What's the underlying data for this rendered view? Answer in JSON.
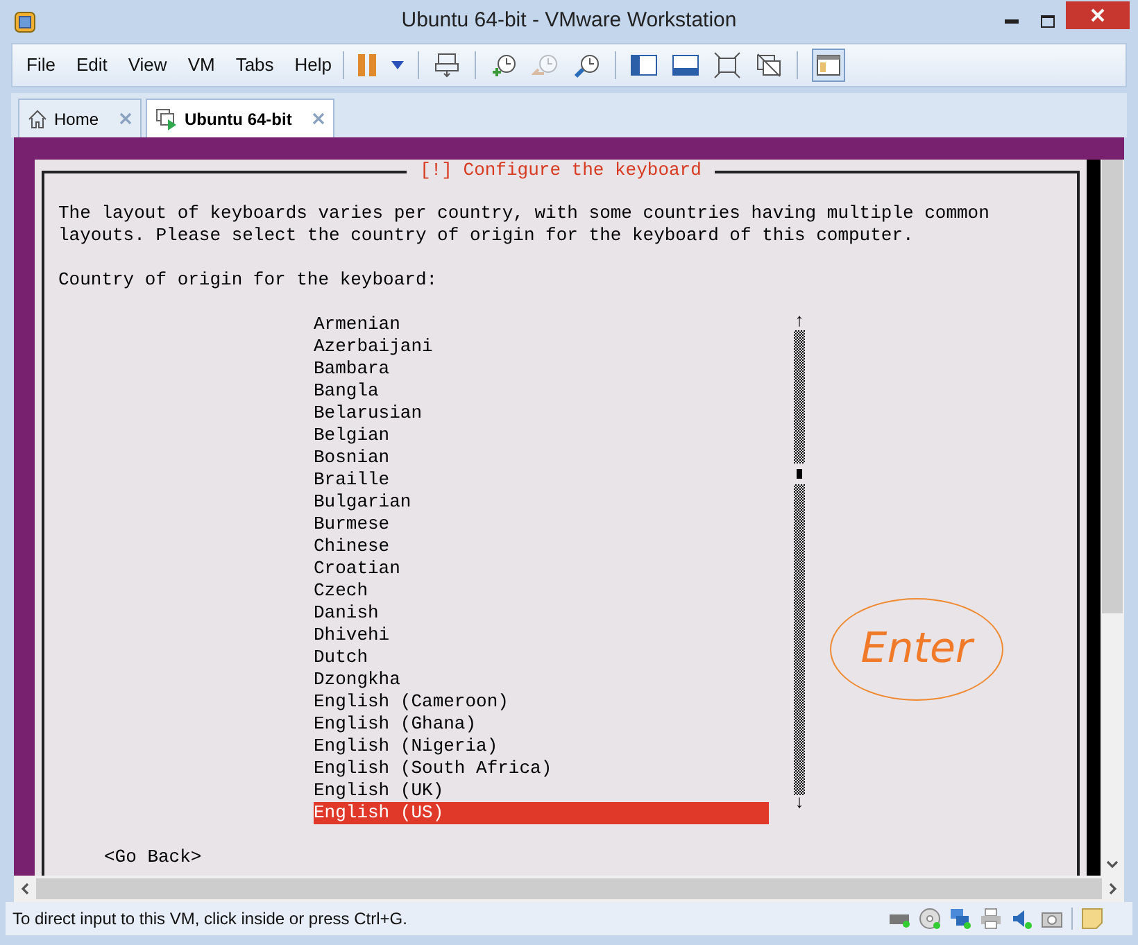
{
  "window": {
    "title": "Ubuntu 64-bit - VMware Workstation"
  },
  "menu": [
    {
      "label": "File"
    },
    {
      "label": "Edit"
    },
    {
      "label": "View"
    },
    {
      "label": "VM"
    },
    {
      "label": "Tabs"
    },
    {
      "label": "Help"
    }
  ],
  "tabs": [
    {
      "label": "Home",
      "kind": "home",
      "selected": false
    },
    {
      "label": "Ubuntu 64-bit",
      "kind": "vm",
      "selected": true
    }
  ],
  "dialog": {
    "title": "[!] Configure the keyboard",
    "description": "The layout of keyboards varies per country, with some countries having multiple common layouts. Please select the country of origin for the keyboard of this computer.",
    "prompt": "Country of origin for the keyboard:",
    "countries": [
      {
        "label": "Armenian",
        "selected": false
      },
      {
        "label": "Azerbaijani",
        "selected": false
      },
      {
        "label": "Bambara",
        "selected": false
      },
      {
        "label": "Bangla",
        "selected": false
      },
      {
        "label": "Belarusian",
        "selected": false
      },
      {
        "label": "Belgian",
        "selected": false
      },
      {
        "label": "Bosnian",
        "selected": false
      },
      {
        "label": "Braille",
        "selected": false
      },
      {
        "label": "Bulgarian",
        "selected": false
      },
      {
        "label": "Burmese",
        "selected": false
      },
      {
        "label": "Chinese",
        "selected": false
      },
      {
        "label": "Croatian",
        "selected": false
      },
      {
        "label": "Czech",
        "selected": false
      },
      {
        "label": "Danish",
        "selected": false
      },
      {
        "label": "Dhivehi",
        "selected": false
      },
      {
        "label": "Dutch",
        "selected": false
      },
      {
        "label": "Dzongkha",
        "selected": false
      },
      {
        "label": "English (Cameroon)",
        "selected": false
      },
      {
        "label": "English (Ghana)",
        "selected": false
      },
      {
        "label": "English (Nigeria)",
        "selected": false
      },
      {
        "label": "English (South Africa)",
        "selected": false
      },
      {
        "label": "English (UK)",
        "selected": false
      },
      {
        "label": "English (US)",
        "selected": true
      }
    ],
    "scroll_up": "↑",
    "scroll_down": "↓",
    "go_back": "<Go Back>"
  },
  "annotation": {
    "label": "Enter"
  },
  "status_bar": {
    "text": "To direct input to this VM, click inside or press Ctrl+G."
  }
}
